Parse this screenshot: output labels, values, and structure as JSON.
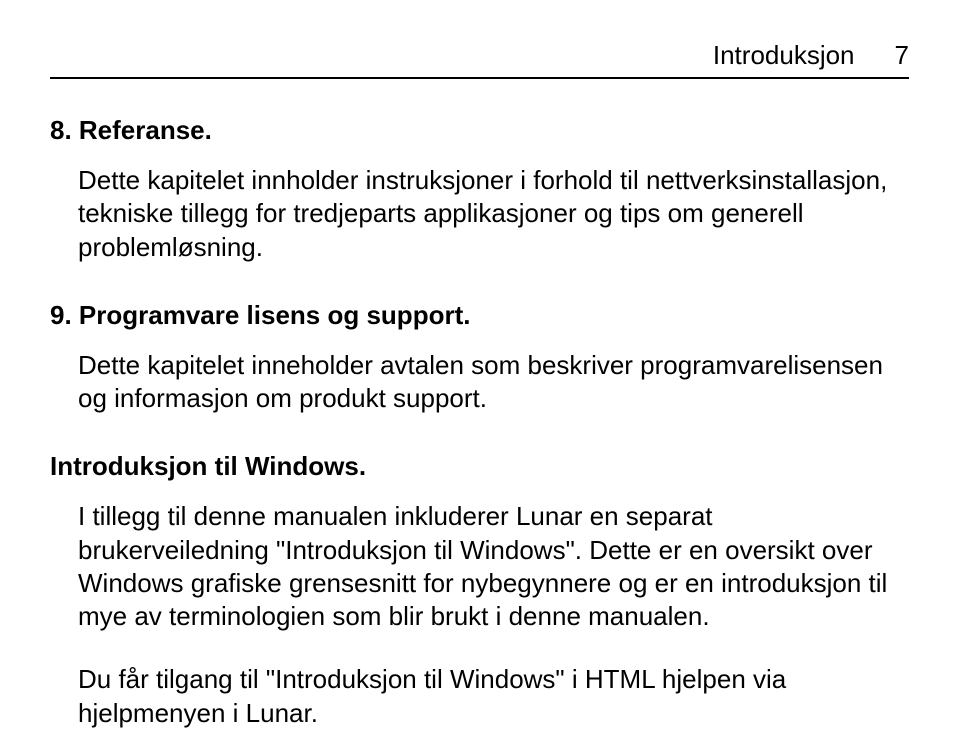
{
  "header": {
    "running_title": "Introduksjon",
    "page_number": "7"
  },
  "sections": {
    "s8": {
      "title": "8. Referanse.",
      "body": "Dette kapitelet innholder instruksjoner i forhold til nettverksinstallasjon, tekniske tillegg for tredjeparts applikasjoner og tips om generell problemløsning."
    },
    "s9": {
      "title": "9. Programvare lisens og support.",
      "body": "Dette kapitelet inneholder avtalen som beskriver programvarelisensen og informasjon om produkt support."
    },
    "intro_win": {
      "title": "Introduksjon til Windows.",
      "body1": "I tillegg til denne manualen inkluderer Lunar en separat brukerveiledning \"Introduksjon til Windows\". Dette er en oversikt over Windows grafiske grensesnitt for nybegynnere og er en introduksjon til mye av terminologien som blir brukt i denne manualen.",
      "body2": "Du får tilgang til \"Introduksjon til Windows\" i HTML hjelpen via hjelpmenyen i Lunar."
    }
  }
}
